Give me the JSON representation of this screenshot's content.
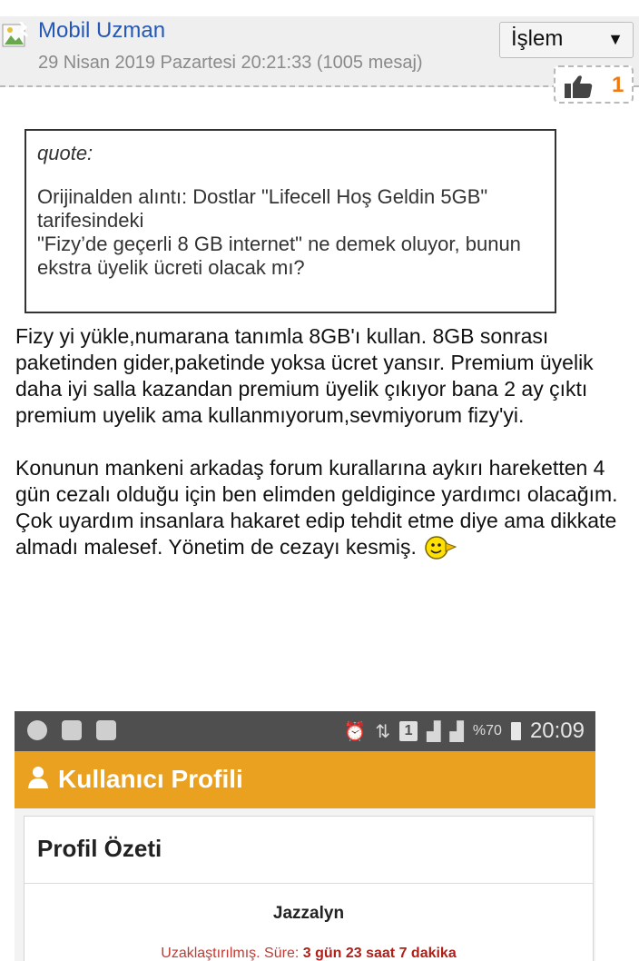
{
  "post": {
    "author": "Mobil Uzman",
    "meta": "29 Nisan 2019 Pazartesi 20:21:33 (1005 mesaj)",
    "action_label": "İşlem",
    "action_arrow": "▼",
    "like_count": "1"
  },
  "quote": {
    "title": "quote:",
    "text": "Orijinalden alıntı: Dostlar \"Lifecell Hoş Geldin 5GB\" tarifesindeki\n\"Fizy’de geçerli 8 GB internet\" ne demek oluyor, bunun ekstra üyelik ücreti olacak mı?"
  },
  "body": {
    "paragraph_1": "Fizy yi yükle,numarana tanımla 8GB'ı kullan. 8GB sonrası paketinden gider,paketinde yoksa ücret yansır. Premium üyelik daha iyi salla kazandan premium üyelik çıkıyor bana 2 ay çıktı premium uyelik ama kullanmıyorum,sevmiyorum fizy'yi.",
    "paragraph_2": "Konunun mankeni arkadaş forum kurallarına aykırı hareketten 4 gün cezalı olduğu için ben elimden geldigince yardımcı olacağım. Çok uyardım insanlara hakaret edip tehdit etme diye ama dikkate almadı malesef. Yönetim de cezayı kesmiş."
  },
  "screenshot": {
    "status_bar": {
      "battery": "%70",
      "time": "20:09",
      "sim": "1"
    },
    "header_title": "Kullanıcı Profili",
    "card_title": "Profil Özeti",
    "username": "Jazzalyn",
    "ban_label": "Uzaklaştırılmış. Süre:",
    "ban_duration": "3 gün 23 saat 7 dakika"
  },
  "colors": {
    "link": "#2458b8",
    "like": "#f07a10",
    "profile_bar": "#e9a11f",
    "ban": "#c23a33"
  }
}
